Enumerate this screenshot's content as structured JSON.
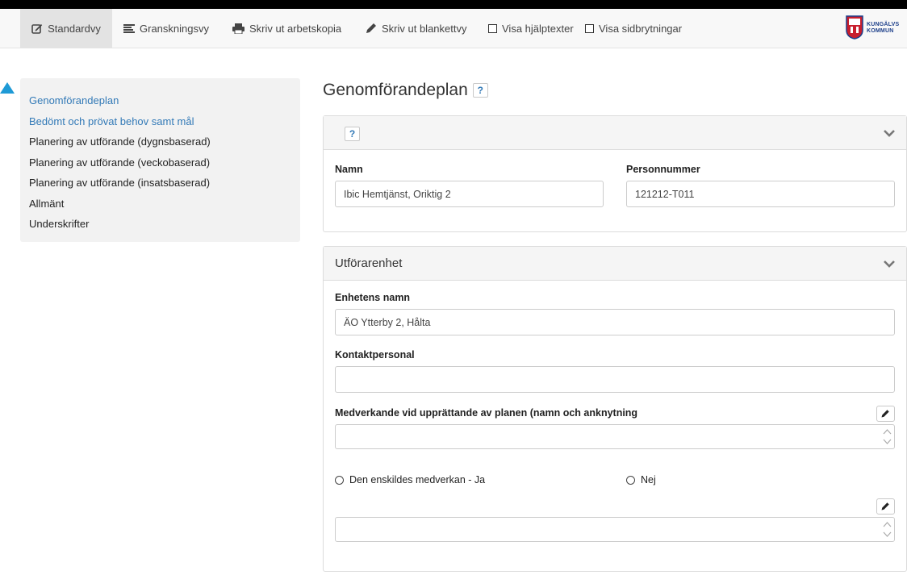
{
  "toolbar": {
    "standardvy": "Standardvy",
    "granskningsvy": "Granskningsvy",
    "skriv_arbetskopia": "Skriv ut arbetskopia",
    "skriv_blankettvy": "Skriv ut blankettvy",
    "visa_hjalptexter": "Visa hjälptexter",
    "visa_sidbrytningar": "Visa sidbrytningar"
  },
  "logo": {
    "line1": "KUNGÄLVS",
    "line2": "KOMMUN"
  },
  "sidebar": {
    "items": [
      {
        "label": "Genomförandeplan"
      },
      {
        "label": "Bedömt och prövat behov samt mål"
      },
      {
        "label": "Planering av utförande (dygnsbaserad)"
      },
      {
        "label": "Planering av utförande (veckobaserad)"
      },
      {
        "label": "Planering av utförande (insatsbaserad)"
      },
      {
        "label": "Allmänt"
      },
      {
        "label": "Underskrifter"
      }
    ]
  },
  "page": {
    "title": "Genomförandeplan",
    "help": "?"
  },
  "panel1": {
    "help": "?",
    "namn_label": "Namn",
    "namn_value": "Ibic Hemtjänst, Oriktig 2",
    "personnummer_label": "Personnummer",
    "personnummer_value": "121212-T011"
  },
  "panel2": {
    "title": "Utförarenhet",
    "enhetens_namn_label": "Enhetens namn",
    "enhetens_namn_value": "ÄO Ytterby 2, Hålta",
    "kontaktpersonal_label": "Kontaktpersonal",
    "kontaktpersonal_value": "",
    "medverkande_label": "Medverkande vid upprättande av planen (namn och anknytning",
    "radio_ja": "Den enskildes medverkan - Ja",
    "radio_nej": "Nej"
  },
  "colors": {
    "link": "#337ab7",
    "accent_marker": "#1e9ad6"
  }
}
